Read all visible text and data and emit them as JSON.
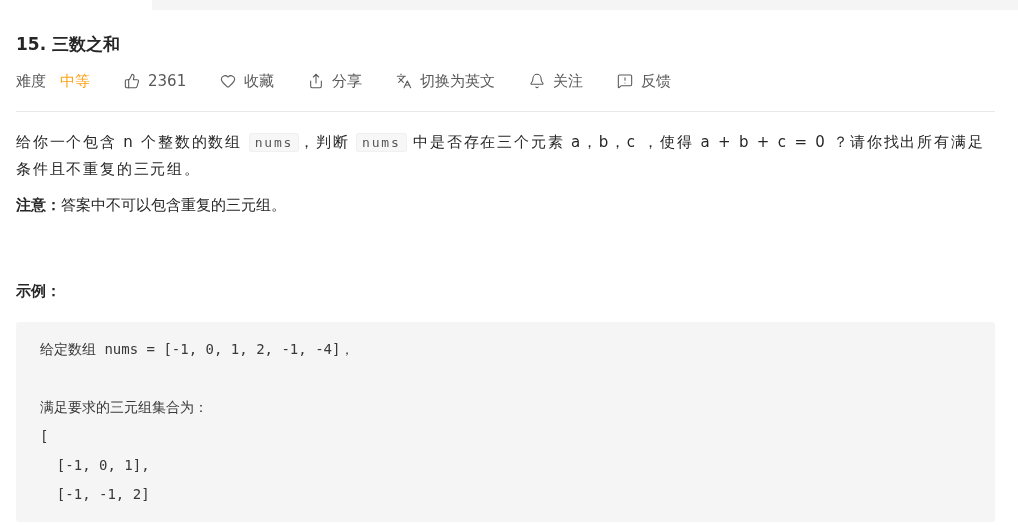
{
  "title": "15. 三数之和",
  "difficulty": {
    "label": "难度",
    "value": "中等"
  },
  "actions": [
    {
      "kind": "like",
      "label": "2361"
    },
    {
      "kind": "favorite",
      "label": "收藏"
    },
    {
      "kind": "share",
      "label": "分享"
    },
    {
      "kind": "translate",
      "label": "切换为英文"
    },
    {
      "kind": "follow",
      "label": "关注"
    },
    {
      "kind": "feedback",
      "label": "反馈"
    }
  ],
  "description": [
    {
      "kind": "text",
      "text": "给你一个包含 n 个整数的数组 "
    },
    {
      "kind": "code",
      "text": "nums"
    },
    {
      "kind": "text",
      "text": "，判断 "
    },
    {
      "kind": "code",
      "text": "nums"
    },
    {
      "kind": "text",
      "text": " 中是否存在三个元素 a，b，c ，使得 a + b + c = 0 ？请你找出所有满足条件且不重复的三元组。"
    }
  ],
  "note": "**注意：**答案中不可以包含重复的三元组。",
  "example_heading": "示例：",
  "example_paragraphs": [
    [
      "给定数组 nums = [-1, 0, 1, 2, -1, -4]，"
    ],
    [
      "满足要求的三元组集合为：",
      "[",
      "  [-1, 0, 1],",
      "  [-1, -1, 2]"
    ]
  ]
}
